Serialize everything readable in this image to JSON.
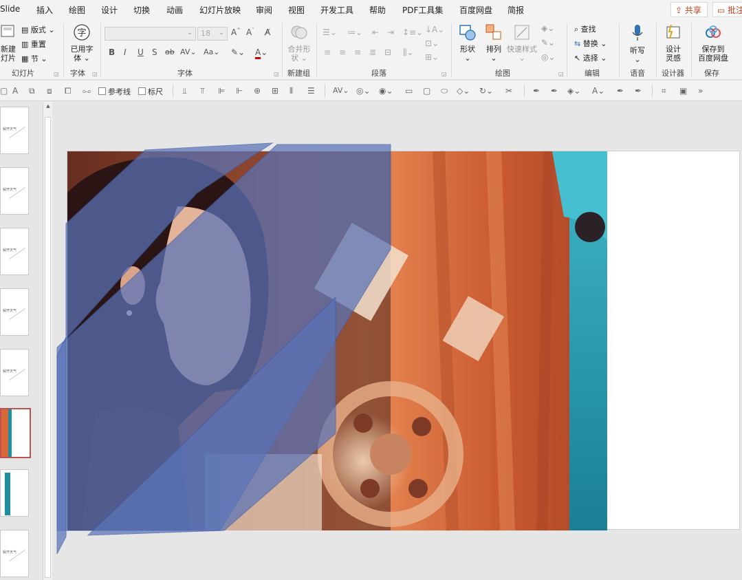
{
  "tabs": {
    "items": [
      "Slide",
      "插入",
      "绘图",
      "设计",
      "切换",
      "动画",
      "幻灯片放映",
      "审阅",
      "视图",
      "开发工具",
      "帮助",
      "PDF工具集",
      "百度网盘",
      "简报"
    ],
    "share_label": "共享",
    "comment_label": "批注"
  },
  "ribbon": {
    "slides": {
      "new_slide": "新建",
      "new_slide_2": "灯片",
      "layout": "版式",
      "reset": "重置",
      "section": "节",
      "group_label": "幻灯片"
    },
    "font_used": {
      "label": "已用字体",
      "line1": "已用字",
      "line2": "体",
      "group_label": "字体"
    },
    "font": {
      "font_name": "",
      "font_size": "18",
      "group_label": "字体"
    },
    "newgroup": {
      "merge_line1": "合并形",
      "merge_line2": "状",
      "group_label": "新建组"
    },
    "paragraph": {
      "group_label": "段落"
    },
    "drawing": {
      "shape": "形状",
      "arrange": "排列",
      "quick_style": "快速样式",
      "group_label": "绘图"
    },
    "editing": {
      "find": "查找",
      "replace": "替换",
      "select": "选择",
      "group_label": "编辑"
    },
    "voice": {
      "dictate": "听写",
      "group_label": "语音"
    },
    "designer": {
      "line1": "设计",
      "line2": "灵感",
      "group_label": "设计器"
    },
    "save": {
      "line1": "保存到",
      "line2": "百度网盘",
      "group_label": "保存"
    }
  },
  "quick_toolbar": {
    "guides_label": "参考线",
    "ruler_label": "标尺"
  },
  "thumbnails": {
    "count": 8,
    "selected_index": 5,
    "mini_caption": "解开天气"
  },
  "colors": {
    "accent": "#c43e1c",
    "overlay_blue": "#5a74b8",
    "selected_border": "#c0504d",
    "curtain_orange": "#d8683a",
    "teal": "#1f8fa3"
  }
}
